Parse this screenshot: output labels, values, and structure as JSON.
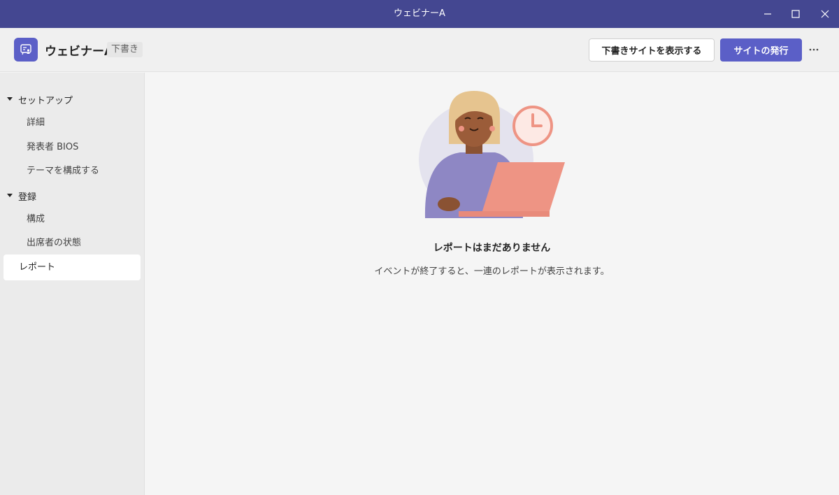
{
  "window": {
    "title": "ウェビナーA",
    "controls": [
      "minimize-icon",
      "maximize-icon",
      "close-icon"
    ]
  },
  "header": {
    "app_icon": "webinar-icon",
    "event_title": "ウェビナーA",
    "status_badge": "下書き",
    "preview_button": "下書きサイトを表示する",
    "publish_button": "サイトの発行",
    "more_icon": "more-options-icon"
  },
  "sidebar": {
    "sections": [
      {
        "label": "セットアップ",
        "expanded": true,
        "items": [
          "詳細",
          "発表者 BIOS",
          "テーマを構成する"
        ]
      },
      {
        "label": "登録",
        "expanded": true,
        "items": [
          "構成",
          "出席者の状態"
        ]
      }
    ],
    "active_item": "レポート"
  },
  "main": {
    "empty_state": {
      "illustration": "person-with-laptop-and-clock",
      "title": "レポートはまだありません",
      "description": "イベントが終了すると、一連のレポートが表示されます。"
    }
  },
  "colors": {
    "titlebar": "#444791",
    "brand": "#5b5fc7",
    "sidebar_bg": "#ebebeb",
    "content_bg": "#f5f5f5"
  }
}
